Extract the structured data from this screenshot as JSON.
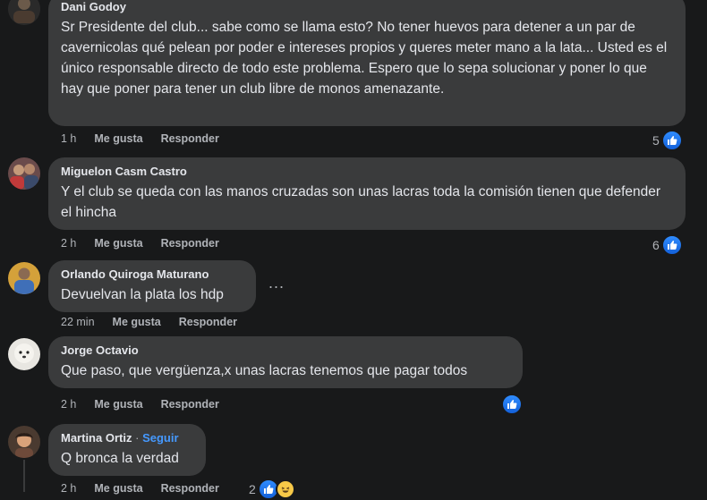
{
  "comments": [
    {
      "author": "Dani Godoy",
      "text": "Sr Presidente del club... sabe como se llama esto? No tener huevos para detener a un par de cavernicolas qué pelean por poder e intereses propios y queres meter mano a la lata... Usted es el único responsable directo de todo este problema. Espero que lo sepa solucionar y poner lo que hay que poner para tener un club libre de monos amenazante.",
      "time": "1 h",
      "like_label": "Me gusta",
      "reply_label": "Responder",
      "reactions": "5",
      "avatar_icon": "user-avatar-icon"
    },
    {
      "author": "Miguelon Casm Castro",
      "text": "Y el club se queda con las manos cruzadas son unas lacras toda la comisión tienen que defender el hincha",
      "time": "2 h",
      "like_label": "Me gusta",
      "reply_label": "Responder",
      "reactions": "6",
      "avatar_icon": "user-avatar-icon"
    },
    {
      "author": "Orlando Quiroga Maturano",
      "text": "Devuelvan la plata los hdp",
      "time": "22 min",
      "like_label": "Me gusta",
      "reply_label": "Responder",
      "more_label": "...",
      "avatar_icon": "user-avatar-icon"
    },
    {
      "author": "Jorge Octavio",
      "text": "Que paso, que vergüenza,x unas lacras tenemos que pagar todos",
      "time": "2 h",
      "like_label": "Me gusta",
      "reply_label": "Responder",
      "avatar_icon": "user-avatar-icon"
    },
    {
      "author": "Martina Ortiz",
      "follow_separator": "·",
      "follow_label": "Seguir",
      "text": "Q bronca la verdad",
      "time": "2 h",
      "like_label": "Me gusta",
      "reply_label": "Responder",
      "reactions": "2",
      "avatar_icon": "user-avatar-icon"
    }
  ],
  "colors": {
    "background": "#18191a",
    "bubble": "#3a3b3c",
    "link": "#4599ff",
    "like_blue": "#2f8cff"
  }
}
